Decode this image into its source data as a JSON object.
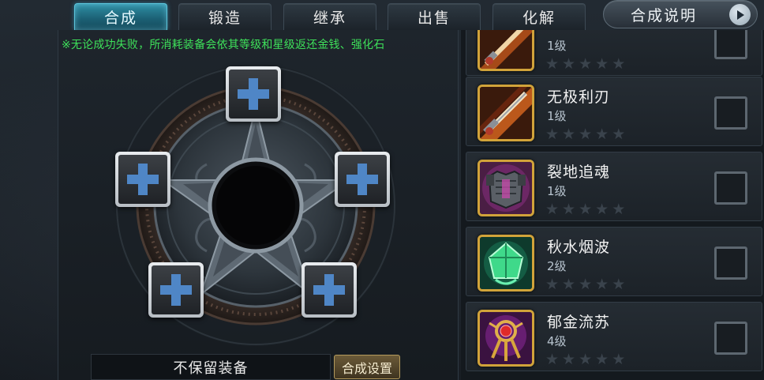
{
  "tabs": [
    {
      "label": "合成",
      "active": true
    },
    {
      "label": "锻造",
      "active": false
    },
    {
      "label": "继承",
      "active": false
    },
    {
      "label": "出售",
      "active": false
    },
    {
      "label": "化解",
      "active": false
    }
  ],
  "help_button": {
    "label": "合成说明",
    "icon": "play-arrow-icon"
  },
  "synthesis": {
    "notice": "※无论成功失败，所消耗装备会依其等级和星级返还金钱、强化石",
    "slots": 5,
    "keep_option": "不保留装备",
    "settings_label": "合成设置"
  },
  "equipment_list": {
    "items": [
      {
        "name": "",
        "level": "1级",
        "stars_filled": 0,
        "stars_total": 5,
        "icon": "sword-icon",
        "checked": false
      },
      {
        "name": "无极利刃",
        "level": "1级",
        "stars_filled": 0,
        "stars_total": 5,
        "icon": "sword-icon",
        "checked": false
      },
      {
        "name": "裂地追魂",
        "level": "1级",
        "stars_filled": 0,
        "stars_total": 5,
        "icon": "armor-icon",
        "checked": false
      },
      {
        "name": "秋水烟波",
        "level": "2级",
        "stars_filled": 0,
        "stars_total": 5,
        "icon": "jade-charm-icon",
        "checked": false
      },
      {
        "name": "郁金流苏",
        "level": "4级",
        "stars_filled": 0,
        "stars_total": 5,
        "icon": "amulet-icon",
        "checked": false
      }
    ]
  },
  "colors": {
    "accent": "#2f8fa5",
    "notice": "#3ee05a",
    "frame_gold": "#d1a33a",
    "slot_plus": "#4f86c6"
  }
}
